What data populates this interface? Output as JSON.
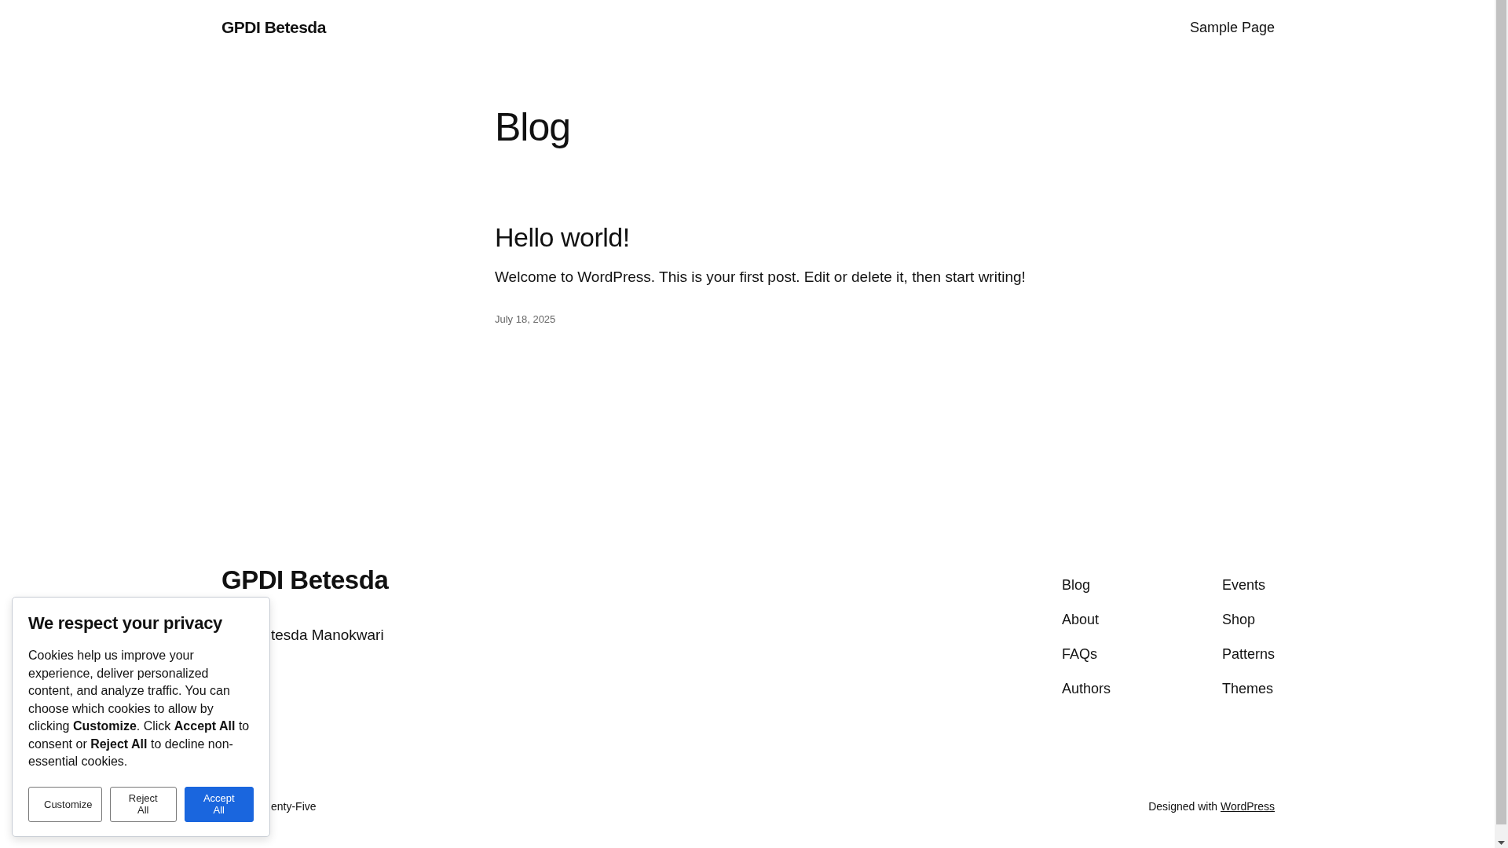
{
  "header": {
    "site_title": "GPDI Betesda",
    "nav": [
      "Sample Page"
    ]
  },
  "main": {
    "heading": "Blog",
    "posts": [
      {
        "title": "Hello world!",
        "excerpt": "Welcome to WordPress. This is your first post. Edit or delete it, then start writing!",
        "date": "July 18, 2025"
      }
    ]
  },
  "footer": {
    "site_title": "GPDI Betesda",
    "tagline": "tesda Manokwari",
    "nav_columns": [
      [
        "Blog",
        "About",
        "FAQs",
        "Authors"
      ],
      [
        "Events",
        "Shop",
        "Patterns",
        "Themes"
      ]
    ],
    "theme_credit": "enty-Five",
    "credit_text": "Designed with",
    "credit_link": "WordPress"
  },
  "cookie_banner": {
    "title": "We respect your privacy",
    "text": "Cookies help us improve your experience, deliver personalized content, and analyze traffic. You can choose which cookies to allow by clicking **Customize**. Click **Accept All** to consent or **Reject All** to decline non-essential cookies.",
    "buttons": [
      {
        "label": "Customize",
        "kind": "outline"
      },
      {
        "label": "Reject All",
        "kind": "outline"
      },
      {
        "label": "Accept All",
        "kind": "primary"
      }
    ]
  }
}
